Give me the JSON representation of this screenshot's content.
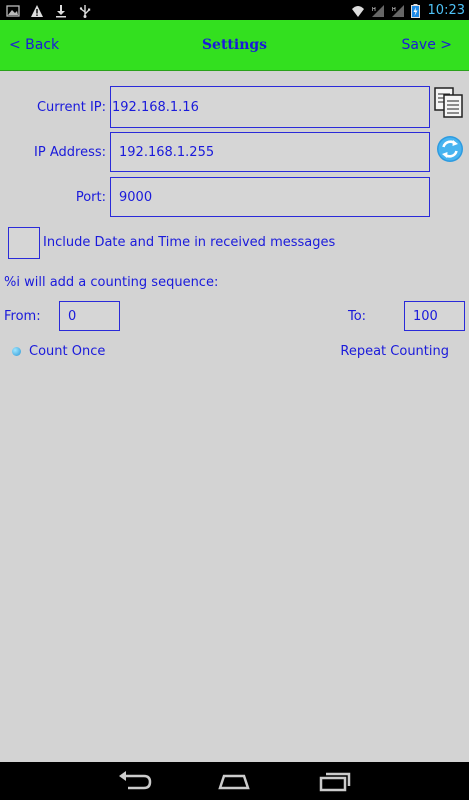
{
  "status_bar": {
    "time": "10:23",
    "icons": [
      "image-notification-icon",
      "warning-icon",
      "download-icon",
      "usb-icon",
      "wifi-icon",
      "signal-icon",
      "signal-icon",
      "battery-icon"
    ]
  },
  "header": {
    "back_label": "< Back",
    "title": "Settings",
    "save_label": "Save >"
  },
  "form": {
    "current_ip_label": "Current IP:",
    "current_ip_value": "192.168.1.16",
    "ip_address_label": "IP Address:",
    "ip_address_value": "192.168.1.255",
    "port_label": "Port:",
    "port_value": "9000",
    "include_datetime_label": "Include Date and Time in received messages",
    "include_datetime_checked": false,
    "counting_note": "%i will add a counting sequence:",
    "from_label": "From:",
    "from_value": "0",
    "to_label": "To:",
    "to_value": "100",
    "count_once_label": "Count Once",
    "repeat_counting_label": "Repeat Counting"
  },
  "colors": {
    "header_bg": "#33e01f",
    "text_blue": "#1a1adb",
    "background": "#d3d3d3",
    "time_color": "#4fc3f7"
  }
}
